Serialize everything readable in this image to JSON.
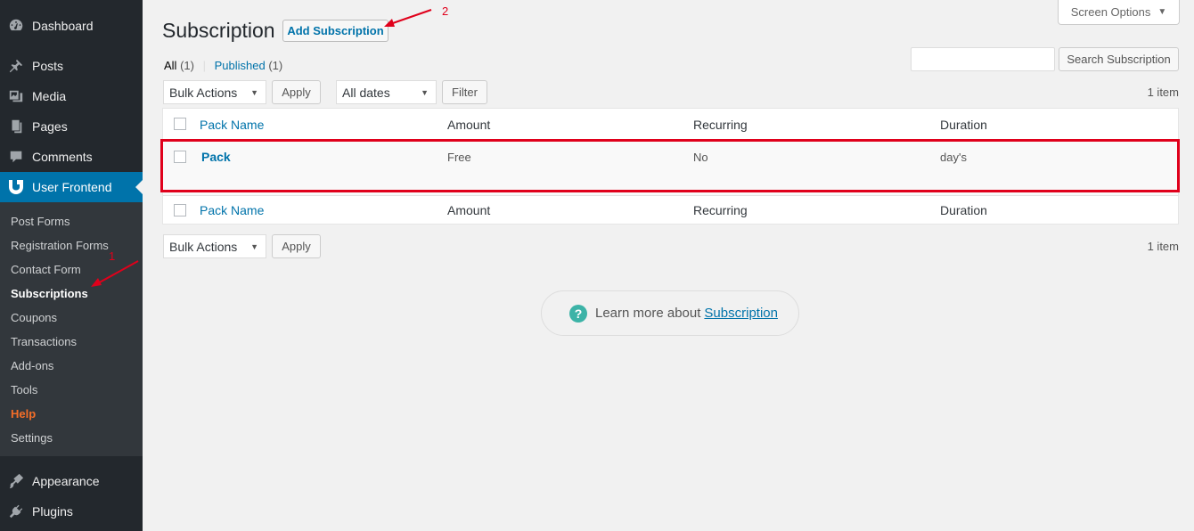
{
  "sidebar": {
    "menu": [
      {
        "label": "Dashboard",
        "icon": "dashboard-icon"
      },
      {
        "label": "Posts",
        "icon": "pin-icon"
      },
      {
        "label": "Media",
        "icon": "media-icon"
      },
      {
        "label": "Pages",
        "icon": "pages-icon"
      },
      {
        "label": "Comments",
        "icon": "comment-icon"
      },
      {
        "label": "User Frontend",
        "icon": "user-frontend-icon"
      },
      {
        "label": "Appearance",
        "icon": "paintbrush-icon"
      },
      {
        "label": "Plugins",
        "icon": "plugin-icon"
      }
    ],
    "submenu": [
      {
        "label": "Post Forms"
      },
      {
        "label": "Registration Forms"
      },
      {
        "label": "Contact Form"
      },
      {
        "label": "Subscriptions"
      },
      {
        "label": "Coupons"
      },
      {
        "label": "Transactions"
      },
      {
        "label": "Add-ons"
      },
      {
        "label": "Tools"
      },
      {
        "label": "Help"
      },
      {
        "label": "Settings"
      }
    ]
  },
  "header": {
    "title": "Subscription",
    "add_button": "Add Subscription",
    "screen_options": "Screen Options"
  },
  "views": {
    "all": "All",
    "all_count": "(1)",
    "separator": "|",
    "published": "Published",
    "published_count": "(1)"
  },
  "search": {
    "value": "",
    "button": "Search Subscription"
  },
  "top_nav": {
    "bulk_actions": "Bulk Actions",
    "apply": "Apply",
    "date_filter": "All dates",
    "filter": "Filter",
    "count": "1 item"
  },
  "bottom_nav": {
    "bulk_actions": "Bulk Actions",
    "apply": "Apply",
    "count": "1 item"
  },
  "table": {
    "columns": [
      "Pack Name",
      "Amount",
      "Recurring",
      "Duration"
    ],
    "rows": [
      {
        "pack_name": "Pack",
        "amount": "Free",
        "recurring": "No",
        "duration": "day's"
      }
    ]
  },
  "help_pill": {
    "text": "Learn more about",
    "link": "Subscription"
  },
  "annotations": {
    "label_1": "1",
    "label_2": "2",
    "color": "#e0001b"
  },
  "colors": {
    "sidebar_bg": "#23282d",
    "submenu_bg": "#32373c",
    "accent": "#0073aa",
    "help_orange": "#f56e28"
  }
}
